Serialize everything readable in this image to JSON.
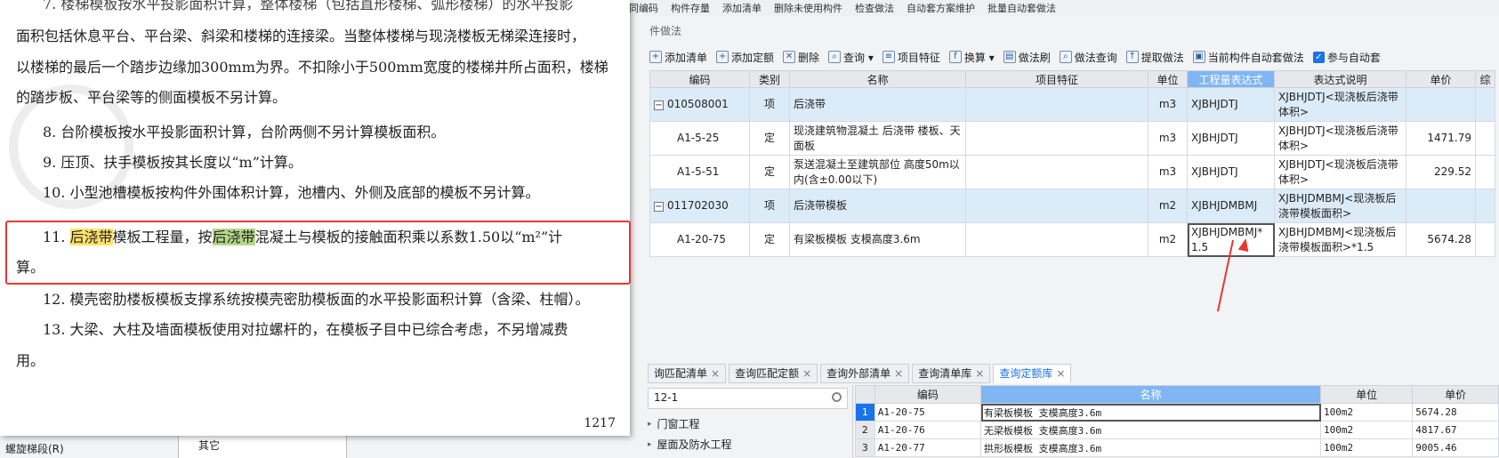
{
  "top_strip": [
    "合同编码",
    "构件存量",
    "添加清单",
    "删除未使用构件",
    "检查做法",
    "自动套方案维护",
    "批量自动套做法"
  ],
  "panel_title": "件做法",
  "toolbar": {
    "items": [
      {
        "icon": "add-list-icon",
        "label": "添加清单"
      },
      {
        "icon": "add-quota-icon",
        "label": "添加定额"
      },
      {
        "icon": "delete-icon",
        "label": "删除"
      },
      {
        "icon": "query-icon",
        "label": "查询 ▾"
      },
      {
        "icon": "feature-icon",
        "label": "项目特征"
      },
      {
        "icon": "fx-icon",
        "label": "换算 ▾"
      },
      {
        "icon": "brush-icon",
        "label": "做法刷"
      },
      {
        "icon": "method-query-icon",
        "label": "做法查询"
      },
      {
        "icon": "extract-icon",
        "label": "提取做法"
      },
      {
        "icon": "auto-apply-icon",
        "label": "当前构件自动套做法"
      }
    ],
    "checkbox_label": "参与自动套"
  },
  "grid": {
    "headers": [
      "编码",
      "类别",
      "名称",
      "项目特征",
      "单位",
      "工程量表达式",
      "表达式说明",
      "单价",
      "综"
    ],
    "rows": [
      {
        "code": "010508001",
        "type": "项",
        "name": "后浇带",
        "feature": "",
        "unit": "m3",
        "expr": "XJBHJDTJ",
        "desc": "XJBHJDTJ<现浇板后浇带体积>",
        "price": "",
        "level": 1
      },
      {
        "code": "A1-5-25",
        "type": "定",
        "name": "现浇建筑物混凝土 后浇带 楼板、天面板",
        "feature": "",
        "unit": "m3",
        "expr": "XJBHJDTJ",
        "desc": "XJBHJDTJ<现浇板后浇带体积>",
        "price": "1471.79",
        "level": 2
      },
      {
        "code": "A1-5-51",
        "type": "定",
        "name": "泵送混凝土至建筑部位 高度50m以内(含±0.00以下)",
        "feature": "",
        "unit": "m3",
        "expr": "XJBHJDTJ",
        "desc": "XJBHJDTJ<现浇板后浇带体积>",
        "price": "229.52",
        "level": 2
      },
      {
        "code": "011702030",
        "type": "项",
        "name": "后浇带模板",
        "feature": "",
        "unit": "m2",
        "expr": "XJBHJDMBMJ",
        "desc": "XJBHJDMBMJ<现浇板后浇带模板面积>",
        "price": "",
        "level": 1
      },
      {
        "code": "A1-20-75",
        "type": "定",
        "name": "有梁板模板 支模高度3.6m",
        "feature": "",
        "unit": "m2",
        "expr": "XJBHJDMBMJ*1.5",
        "desc": "XJBHJDMBMJ<现浇板后浇带模板面积>*1.5",
        "price": "5674.28",
        "level": 2
      }
    ]
  },
  "bottom_tabs": [
    "询匹配清单",
    "查询匹配定额",
    "查询外部清单",
    "查询清单库",
    "查询定额库"
  ],
  "search_value": "12-1",
  "library": [
    "门窗工程",
    "屋面及防水工程"
  ],
  "quota_grid": {
    "headers": [
      "",
      "编码",
      "名称",
      "单位",
      "单价"
    ],
    "rows": [
      {
        "idx": "1",
        "code": "A1-20-75",
        "name": "有梁板模板 支模高度3.6m",
        "unit": "100m2",
        "price": "5674.28"
      },
      {
        "idx": "2",
        "code": "A1-20-76",
        "name": "无梁板模板 支模高度3.6m",
        "unit": "100m2",
        "price": "4817.67"
      },
      {
        "idx": "3",
        "code": "A1-20-77",
        "name": "拱形板模板 支模高度3.6m",
        "unit": "100m2",
        "price": "9005.46"
      }
    ]
  },
  "left_bottom": {
    "a": "螺旋梯段(R)",
    "b": "其它"
  },
  "doc": {
    "line0": "7. 楼梯模板按水平投影面积计算，整体楼梯（包括直形楼梯、弧形楼梯）的水平投影",
    "line1": "面积包括休息平台、平台梁、斜梁和楼梯的连接梁。当整体楼梯与现浇楼板无梯梁连接时，",
    "line2": "以楼梯的最后一个踏步边缘加300mm为界。不扣除小于500mm宽度的楼梯井所占面积，楼梯",
    "line3": "的踏步板、平台梁等的侧面模板不另计算。",
    "line4": "8. 台阶模板按水平投影面积计算，台阶两侧不另计算模板面积。",
    "line5": "9. 压顶、扶手模板按其长度以“m”计算。",
    "line6": "10. 小型池槽模板按构件外围体积计算，池槽内、外侧及底部的模板不另计算。",
    "line7_prefix": "11. ",
    "line7_hl1": "后浇带",
    "line7_mid": "模板工程量，按",
    "line7_hl2": "后浇带",
    "line7_suffix": "混凝土与模板的接触面积乘以系数1.50以“m²”计",
    "line8": "算。",
    "line9": "12. 模壳密肋楼板模板支撑系统按模壳密肋模板面的水平投影面积计算（含梁、柱帽）。",
    "line10": "13. 大梁、大柱及墙面模板使用对拉螺杆的，在模板子目中已综合考虑，不另增减费",
    "line11": "用。",
    "page_no": "1217"
  }
}
